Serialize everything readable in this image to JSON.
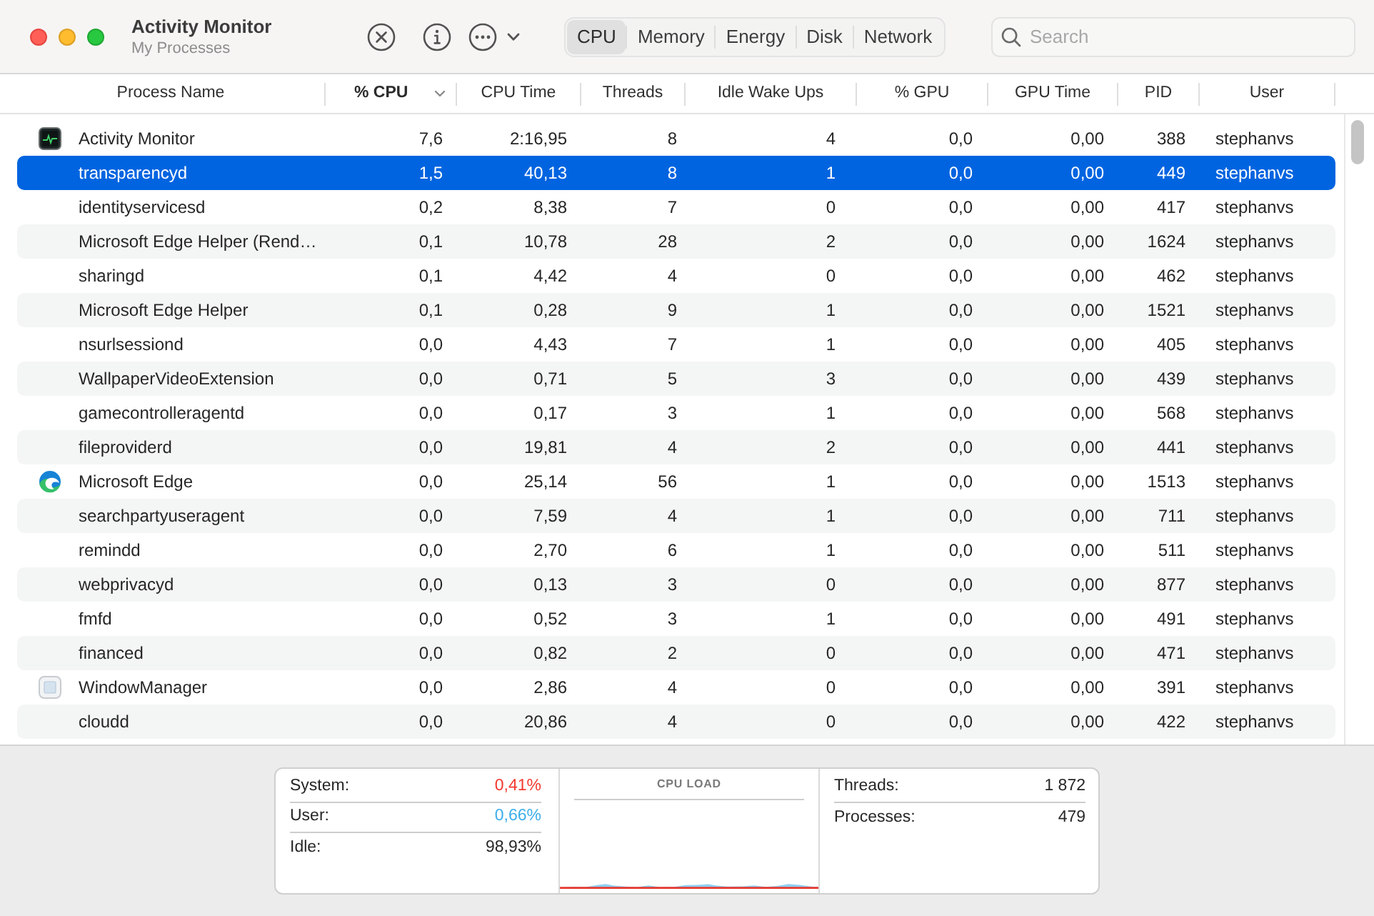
{
  "window": {
    "title": "Activity Monitor",
    "subtitle": "My Processes"
  },
  "tabs": [
    {
      "label": "CPU",
      "selected": true
    },
    {
      "label": "Memory",
      "selected": false
    },
    {
      "label": "Energy",
      "selected": false
    },
    {
      "label": "Disk",
      "selected": false
    },
    {
      "label": "Network",
      "selected": false
    }
  ],
  "search": {
    "placeholder": "Search"
  },
  "table": {
    "columns": [
      {
        "label": "Process Name",
        "sorted": false
      },
      {
        "label": "% CPU",
        "sorted": true
      },
      {
        "label": "CPU Time",
        "sorted": false
      },
      {
        "label": "Threads",
        "sorted": false
      },
      {
        "label": "Idle Wake Ups",
        "sorted": false
      },
      {
        "label": "% GPU",
        "sorted": false
      },
      {
        "label": "GPU Time",
        "sorted": false
      },
      {
        "label": "PID",
        "sorted": false
      },
      {
        "label": "User",
        "sorted": false
      }
    ],
    "rows": [
      {
        "kind": "monitor",
        "selected": false,
        "cells": [
          "Activity Monitor",
          "7,6",
          "2:16,95",
          "8",
          "4",
          "0,0",
          "0,00",
          "388",
          "stephanvs"
        ]
      },
      {
        "kind": "plain",
        "selected": true,
        "cells": [
          "transparencyd",
          "1,5",
          "40,13",
          "8",
          "1",
          "0,0",
          "0,00",
          "449",
          "stephanvs"
        ]
      },
      {
        "kind": "plain",
        "selected": false,
        "cells": [
          "identityservicesd",
          "0,2",
          "8,38",
          "7",
          "0",
          "0,0",
          "0,00",
          "417",
          "stephanvs"
        ]
      },
      {
        "kind": "plain",
        "selected": false,
        "cells": [
          "Microsoft Edge Helper (Rend…",
          "0,1",
          "10,78",
          "28",
          "2",
          "0,0",
          "0,00",
          "1624",
          "stephanvs"
        ]
      },
      {
        "kind": "plain",
        "selected": false,
        "cells": [
          "sharingd",
          "0,1",
          "4,42",
          "4",
          "0",
          "0,0",
          "0,00",
          "462",
          "stephanvs"
        ]
      },
      {
        "kind": "plain",
        "selected": false,
        "cells": [
          "Microsoft Edge Helper",
          "0,1",
          "0,28",
          "9",
          "1",
          "0,0",
          "0,00",
          "1521",
          "stephanvs"
        ]
      },
      {
        "kind": "plain",
        "selected": false,
        "cells": [
          "nsurlsessiond",
          "0,0",
          "4,43",
          "7",
          "1",
          "0,0",
          "0,00",
          "405",
          "stephanvs"
        ]
      },
      {
        "kind": "plain",
        "selected": false,
        "cells": [
          "WallpaperVideoExtension",
          "0,0",
          "0,71",
          "5",
          "3",
          "0,0",
          "0,00",
          "439",
          "stephanvs"
        ]
      },
      {
        "kind": "plain",
        "selected": false,
        "cells": [
          "gamecontrolleragentd",
          "0,0",
          "0,17",
          "3",
          "1",
          "0,0",
          "0,00",
          "568",
          "stephanvs"
        ]
      },
      {
        "kind": "plain",
        "selected": false,
        "cells": [
          "fileproviderd",
          "0,0",
          "19,81",
          "4",
          "2",
          "0,0",
          "0,00",
          "441",
          "stephanvs"
        ]
      },
      {
        "kind": "browser",
        "selected": false,
        "cells": [
          "Microsoft Edge",
          "0,0",
          "25,14",
          "56",
          "1",
          "0,0",
          "0,00",
          "1513",
          "stephanvs"
        ]
      },
      {
        "kind": "plain",
        "selected": false,
        "cells": [
          "searchpartyuseragent",
          "0,0",
          "7,59",
          "4",
          "1",
          "0,0",
          "0,00",
          "711",
          "stephanvs"
        ]
      },
      {
        "kind": "plain",
        "selected": false,
        "cells": [
          "remindd",
          "0,0",
          "2,70",
          "6",
          "1",
          "0,0",
          "0,00",
          "511",
          "stephanvs"
        ]
      },
      {
        "kind": "plain",
        "selected": false,
        "cells": [
          "webprivacyd",
          "0,0",
          "0,13",
          "3",
          "0",
          "0,0",
          "0,00",
          "877",
          "stephanvs"
        ]
      },
      {
        "kind": "plain",
        "selected": false,
        "cells": [
          "fmfd",
          "0,0",
          "0,52",
          "3",
          "1",
          "0,0",
          "0,00",
          "491",
          "stephanvs"
        ]
      },
      {
        "kind": "plain",
        "selected": false,
        "cells": [
          "financed",
          "0,0",
          "0,82",
          "2",
          "0",
          "0,0",
          "0,00",
          "471",
          "stephanvs"
        ]
      },
      {
        "kind": "manager",
        "selected": false,
        "cells": [
          "WindowManager",
          "0,0",
          "2,86",
          "4",
          "0",
          "0,0",
          "0,00",
          "391",
          "stephanvs"
        ]
      },
      {
        "kind": "plain",
        "selected": false,
        "cells": [
          "cloudd",
          "0,0",
          "20,86",
          "4",
          "0",
          "0,0",
          "0,00",
          "422",
          "stephanvs"
        ]
      }
    ]
  },
  "summary": {
    "cpu": [
      {
        "label": "System:",
        "value": "0,41%",
        "color": "#f3392f"
      },
      {
        "label": "User:",
        "value": "0,66%",
        "color": "#3daee9"
      },
      {
        "label": "Idle:",
        "value": "98,93%",
        "color": "#262626"
      }
    ],
    "load_graph": {
      "title": "CPU LOAD"
    },
    "totals": [
      {
        "label": "Threads:",
        "value": "1 872"
      },
      {
        "label": "Processes:",
        "value": "479"
      }
    ]
  }
}
